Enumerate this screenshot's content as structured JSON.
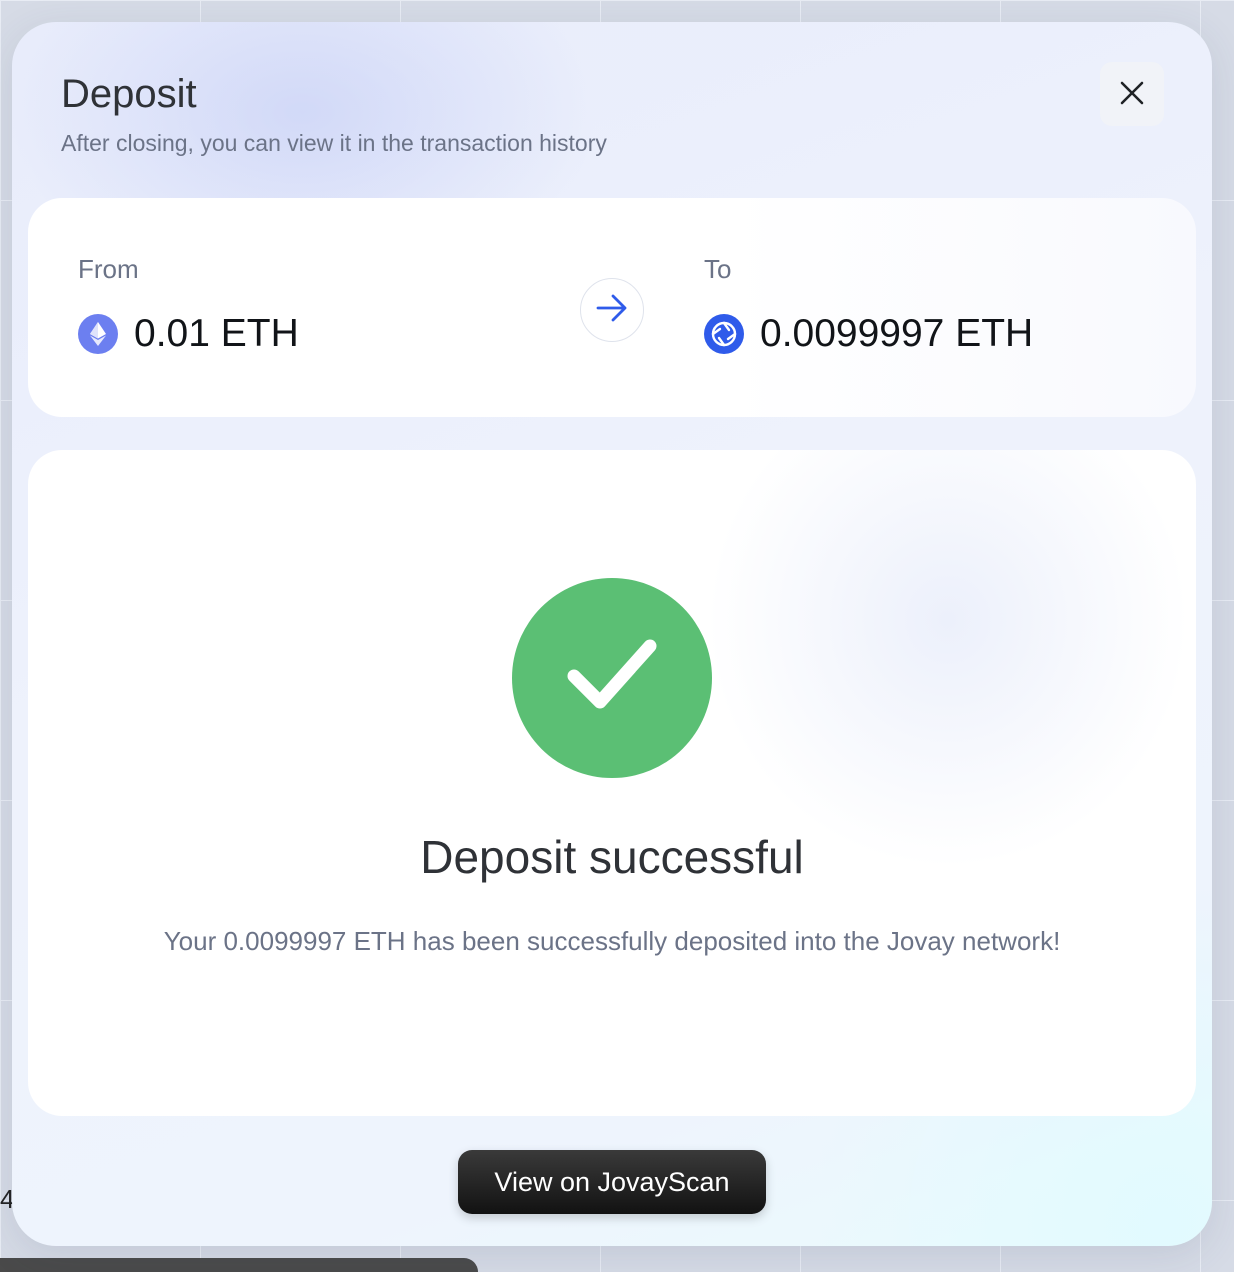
{
  "modal": {
    "title": "Deposit",
    "subtitle": "After closing, you can view it in the transaction history",
    "close_icon": "close-icon"
  },
  "transfer": {
    "from": {
      "label": "From",
      "amount": "0.01 ETH",
      "token_icon": "ethereum-icon"
    },
    "to": {
      "label": "To",
      "amount": "0.0099997 ETH",
      "token_icon": "jovay-icon"
    },
    "arrow_icon": "arrow-right-icon"
  },
  "status": {
    "icon": "check-icon",
    "title": "Deposit successful",
    "message": "Your 0.0099997 ETH has been successfully deposited into the Jovay network!"
  },
  "actions": {
    "view_explorer_label": "View on JovayScan"
  },
  "colors": {
    "success": "#5bbf74",
    "accent": "#2f5bea",
    "eth": "#6c7ff0"
  }
}
